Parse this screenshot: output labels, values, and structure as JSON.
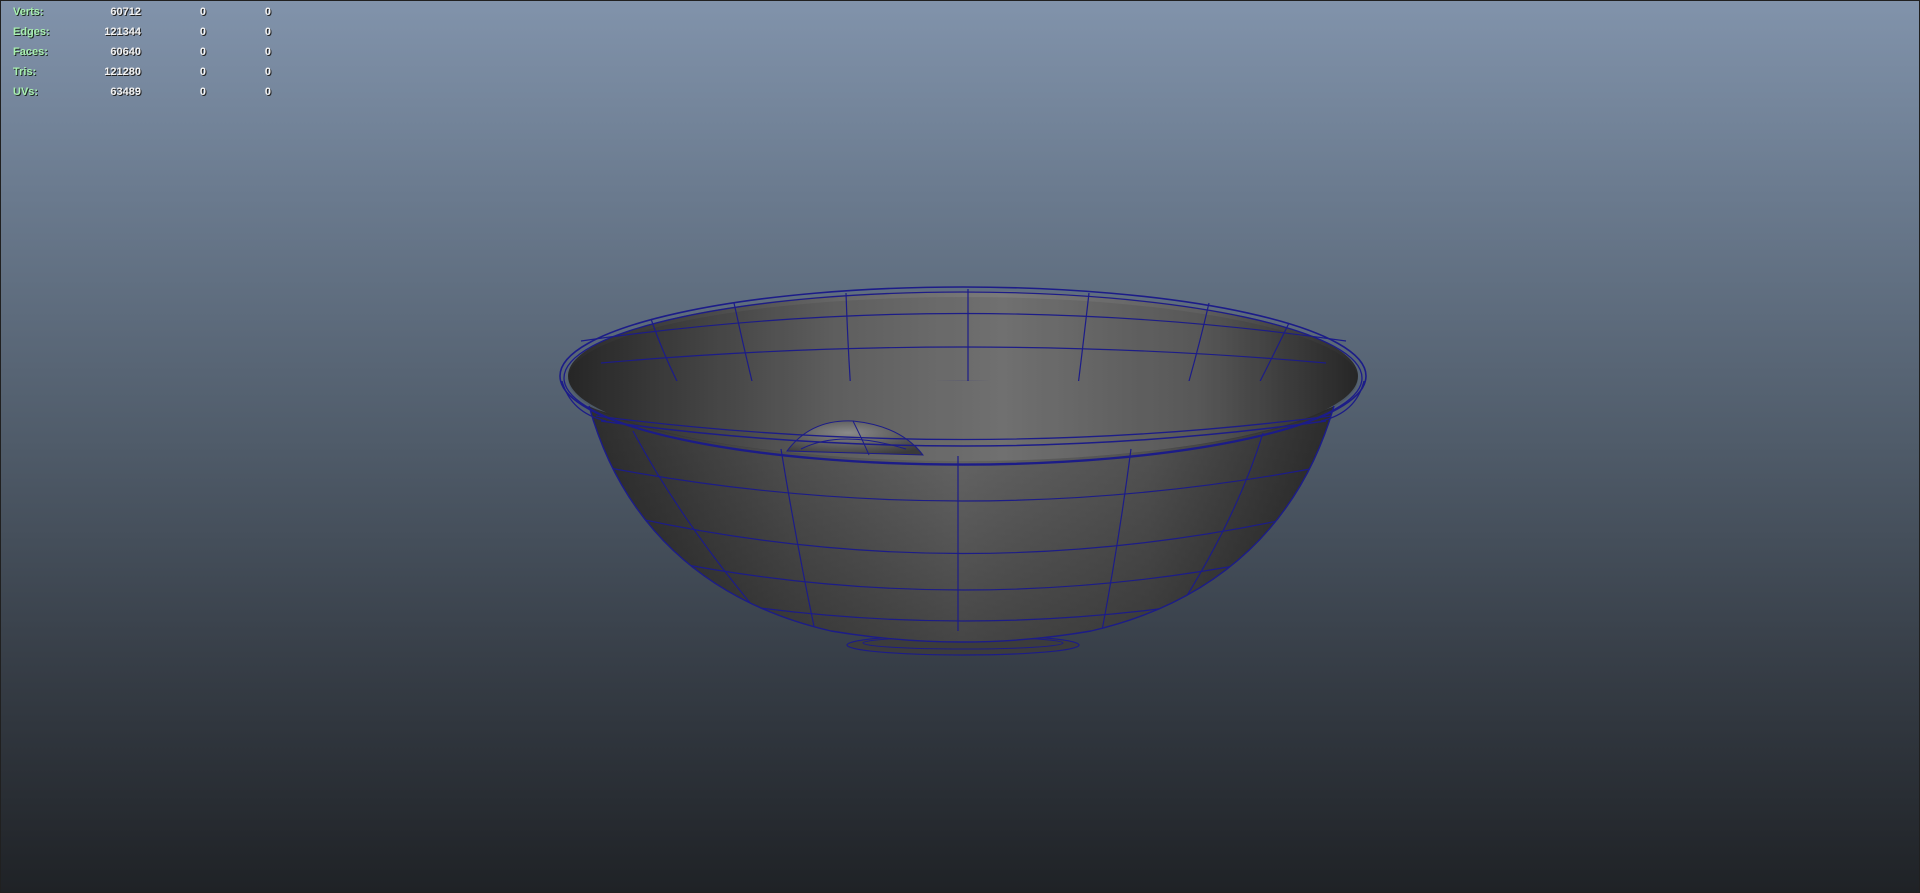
{
  "viewport": {
    "name": "3D viewport",
    "gradient_top": "#8193ab",
    "gradient_bottom": "#1f2226",
    "wireframe_color": "#1c1c88",
    "object_color": "#5b5b5b"
  },
  "hud": {
    "rows": [
      {
        "label": "Verts:",
        "values": [
          "60712",
          "0",
          "0"
        ]
      },
      {
        "label": "Edges:",
        "values": [
          "121344",
          "0",
          "0"
        ]
      },
      {
        "label": "Faces:",
        "values": [
          "60640",
          "0",
          "0"
        ]
      },
      {
        "label": "Tris:",
        "values": [
          "121280",
          "0",
          "0"
        ]
      },
      {
        "label": "UVs:",
        "values": [
          "63489",
          "0",
          "0"
        ]
      }
    ]
  }
}
